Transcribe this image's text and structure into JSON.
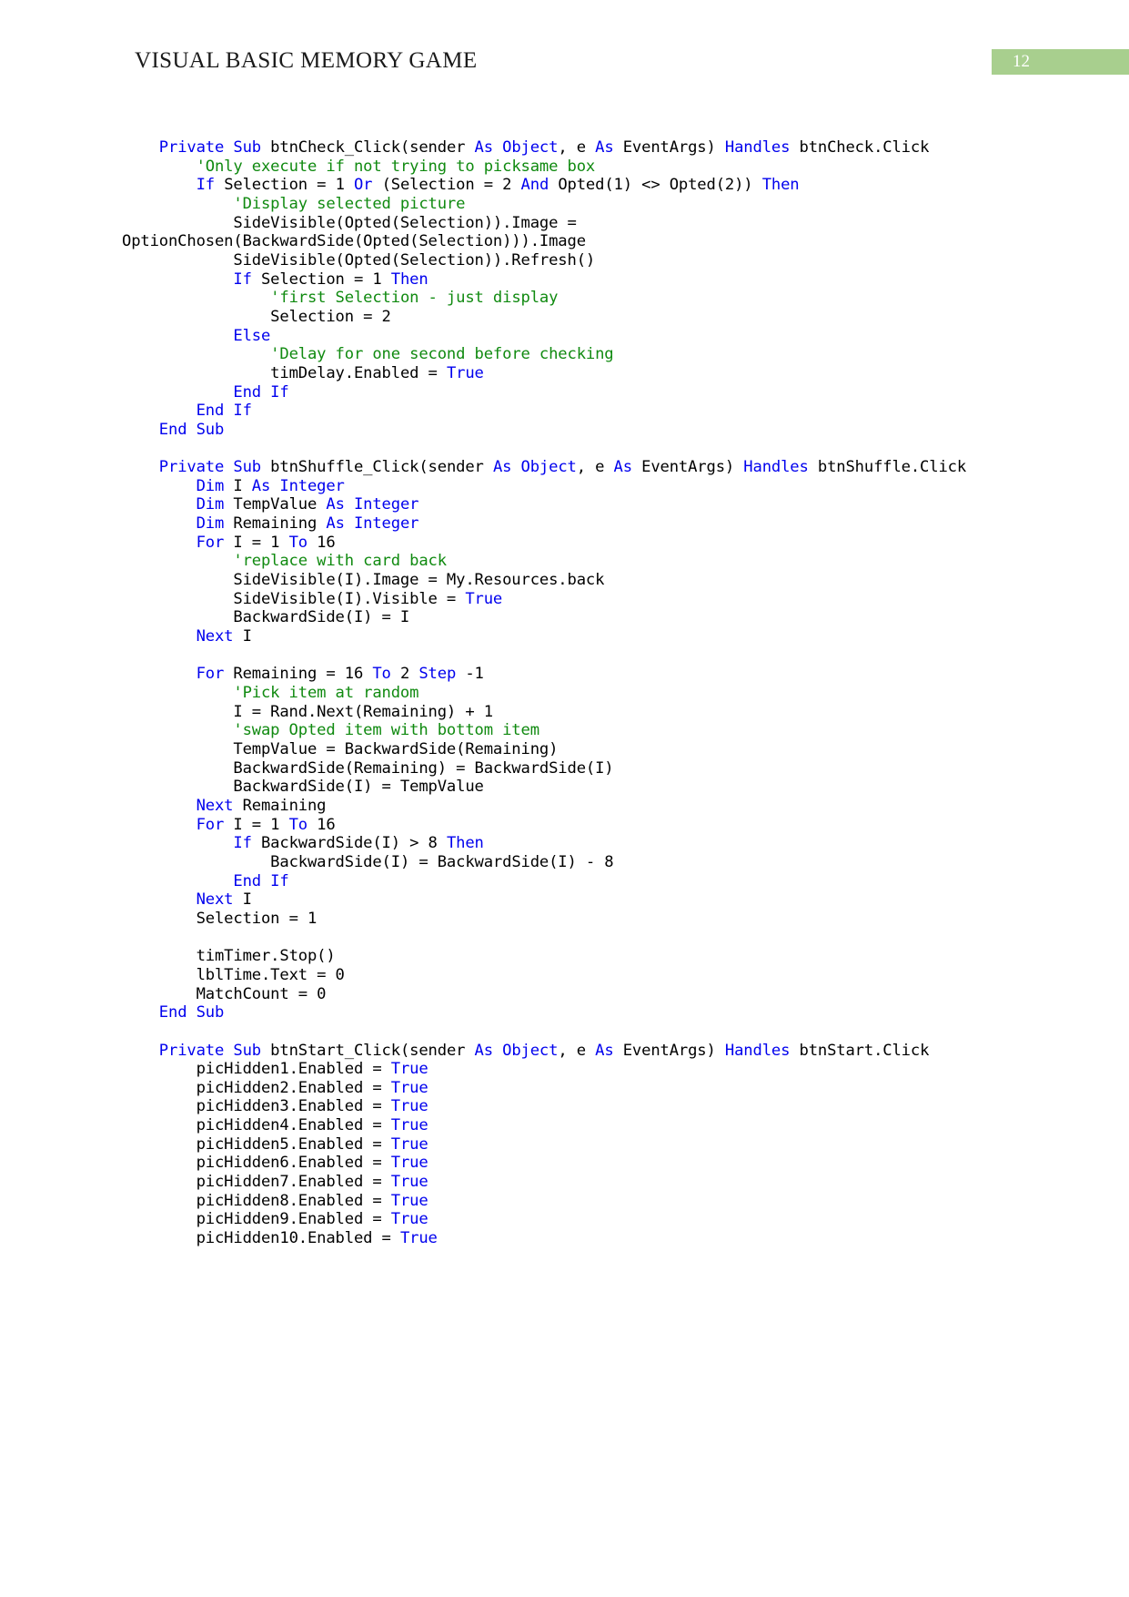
{
  "header": {
    "document_title": "VISUAL BASIC MEMORY GAME",
    "page_number": "12",
    "badge_color": "#a8cf8e"
  },
  "syntax_colors": {
    "keyword": "#0000ee",
    "comment": "#108a10",
    "identifier": "#000000"
  },
  "code": {
    "language": "Visual Basic .NET",
    "lines": [
      [
        {
          "t": "    ",
          "c": "idn"
        },
        {
          "t": "Private Sub",
          "c": "kw"
        },
        {
          "t": " btnCheck_Click(sender ",
          "c": "idn"
        },
        {
          "t": "As Object",
          "c": "kw"
        },
        {
          "t": ", e ",
          "c": "idn"
        },
        {
          "t": "As",
          "c": "kw"
        },
        {
          "t": " EventArgs) ",
          "c": "idn"
        },
        {
          "t": "Handles",
          "c": "kw"
        },
        {
          "t": " btnCheck.Click",
          "c": "idn"
        }
      ],
      [
        {
          "t": "        ",
          "c": "idn"
        },
        {
          "t": "'Only execute if not trying to picksame box",
          "c": "cmt"
        }
      ],
      [
        {
          "t": "        ",
          "c": "idn"
        },
        {
          "t": "If",
          "c": "kw"
        },
        {
          "t": " Selection = 1 ",
          "c": "idn"
        },
        {
          "t": "Or",
          "c": "kw"
        },
        {
          "t": " (Selection = 2 ",
          "c": "idn"
        },
        {
          "t": "And",
          "c": "kw"
        },
        {
          "t": " Opted(1) <> Opted(2)) ",
          "c": "idn"
        },
        {
          "t": "Then",
          "c": "kw"
        }
      ],
      [
        {
          "t": "            ",
          "c": "idn"
        },
        {
          "t": "'Display selected picture",
          "c": "cmt"
        }
      ],
      [
        {
          "t": "            SideVisible(Opted(Selection)).Image = OptionChosen(BackwardSide(Opted(Selection))).Image",
          "c": "idn"
        }
      ],
      [
        {
          "t": "            SideVisible(Opted(Selection)).Refresh()",
          "c": "idn"
        }
      ],
      [
        {
          "t": "            ",
          "c": "idn"
        },
        {
          "t": "If",
          "c": "kw"
        },
        {
          "t": " Selection = 1 ",
          "c": "idn"
        },
        {
          "t": "Then",
          "c": "kw"
        }
      ],
      [
        {
          "t": "                ",
          "c": "idn"
        },
        {
          "t": "'first Selection - just display",
          "c": "cmt"
        }
      ],
      [
        {
          "t": "                Selection = 2",
          "c": "idn"
        }
      ],
      [
        {
          "t": "            ",
          "c": "idn"
        },
        {
          "t": "Else",
          "c": "kw"
        }
      ],
      [
        {
          "t": "                ",
          "c": "idn"
        },
        {
          "t": "'Delay for one second before checking",
          "c": "cmt"
        }
      ],
      [
        {
          "t": "                timDelay.Enabled = ",
          "c": "idn"
        },
        {
          "t": "True",
          "c": "kw"
        }
      ],
      [
        {
          "t": "            ",
          "c": "idn"
        },
        {
          "t": "End If",
          "c": "kw"
        }
      ],
      [
        {
          "t": "        ",
          "c": "idn"
        },
        {
          "t": "End If",
          "c": "kw"
        }
      ],
      [
        {
          "t": "    ",
          "c": "idn"
        },
        {
          "t": "End Sub",
          "c": "kw"
        }
      ],
      [
        {
          "t": "",
          "c": "idn"
        }
      ],
      [
        {
          "t": "    ",
          "c": "idn"
        },
        {
          "t": "Private Sub",
          "c": "kw"
        },
        {
          "t": " btnShuffle_Click(sender ",
          "c": "idn"
        },
        {
          "t": "As Object",
          "c": "kw"
        },
        {
          "t": ", e ",
          "c": "idn"
        },
        {
          "t": "As",
          "c": "kw"
        },
        {
          "t": " EventArgs) ",
          "c": "idn"
        },
        {
          "t": "Handles",
          "c": "kw"
        },
        {
          "t": " btnShuffle.Click",
          "c": "idn"
        }
      ],
      [
        {
          "t": "        ",
          "c": "idn"
        },
        {
          "t": "Dim",
          "c": "kw"
        },
        {
          "t": " I ",
          "c": "idn"
        },
        {
          "t": "As Integer",
          "c": "kw"
        }
      ],
      [
        {
          "t": "        ",
          "c": "idn"
        },
        {
          "t": "Dim",
          "c": "kw"
        },
        {
          "t": " TempValue ",
          "c": "idn"
        },
        {
          "t": "As Integer",
          "c": "kw"
        }
      ],
      [
        {
          "t": "        ",
          "c": "idn"
        },
        {
          "t": "Dim",
          "c": "kw"
        },
        {
          "t": " Remaining ",
          "c": "idn"
        },
        {
          "t": "As Integer",
          "c": "kw"
        }
      ],
      [
        {
          "t": "        ",
          "c": "idn"
        },
        {
          "t": "For",
          "c": "kw"
        },
        {
          "t": " I = 1 ",
          "c": "idn"
        },
        {
          "t": "To",
          "c": "kw"
        },
        {
          "t": " 16",
          "c": "idn"
        }
      ],
      [
        {
          "t": "            ",
          "c": "idn"
        },
        {
          "t": "'replace with card back",
          "c": "cmt"
        }
      ],
      [
        {
          "t": "            SideVisible(I).Image = My.Resources.back",
          "c": "idn"
        }
      ],
      [
        {
          "t": "            SideVisible(I).Visible = ",
          "c": "idn"
        },
        {
          "t": "True",
          "c": "kw"
        }
      ],
      [
        {
          "t": "            BackwardSide(I) = I",
          "c": "idn"
        }
      ],
      [
        {
          "t": "        ",
          "c": "idn"
        },
        {
          "t": "Next",
          "c": "kw"
        },
        {
          "t": " I",
          "c": "idn"
        }
      ],
      [
        {
          "t": "",
          "c": "idn"
        }
      ],
      [
        {
          "t": "        ",
          "c": "idn"
        },
        {
          "t": "For",
          "c": "kw"
        },
        {
          "t": " Remaining = 16 ",
          "c": "idn"
        },
        {
          "t": "To",
          "c": "kw"
        },
        {
          "t": " 2 ",
          "c": "idn"
        },
        {
          "t": "Step",
          "c": "kw"
        },
        {
          "t": " -1",
          "c": "idn"
        }
      ],
      [
        {
          "t": "            ",
          "c": "idn"
        },
        {
          "t": "'Pick item at random",
          "c": "cmt"
        }
      ],
      [
        {
          "t": "            I = Rand.Next(Remaining) + 1",
          "c": "idn"
        }
      ],
      [
        {
          "t": "            ",
          "c": "idn"
        },
        {
          "t": "'swap Opted item with bottom item",
          "c": "cmt"
        }
      ],
      [
        {
          "t": "            TempValue = BackwardSide(Remaining)",
          "c": "idn"
        }
      ],
      [
        {
          "t": "            BackwardSide(Remaining) = BackwardSide(I)",
          "c": "idn"
        }
      ],
      [
        {
          "t": "            BackwardSide(I) = TempValue",
          "c": "idn"
        }
      ],
      [
        {
          "t": "        ",
          "c": "idn"
        },
        {
          "t": "Next",
          "c": "kw"
        },
        {
          "t": " Remaining",
          "c": "idn"
        }
      ],
      [
        {
          "t": "        ",
          "c": "idn"
        },
        {
          "t": "For",
          "c": "kw"
        },
        {
          "t": " I = 1 ",
          "c": "idn"
        },
        {
          "t": "To",
          "c": "kw"
        },
        {
          "t": " 16",
          "c": "idn"
        }
      ],
      [
        {
          "t": "            ",
          "c": "idn"
        },
        {
          "t": "If",
          "c": "kw"
        },
        {
          "t": " BackwardSide(I) > 8 ",
          "c": "idn"
        },
        {
          "t": "Then",
          "c": "kw"
        }
      ],
      [
        {
          "t": "                BackwardSide(I) = BackwardSide(I) - 8",
          "c": "idn"
        }
      ],
      [
        {
          "t": "            ",
          "c": "idn"
        },
        {
          "t": "End If",
          "c": "kw"
        }
      ],
      [
        {
          "t": "        ",
          "c": "idn"
        },
        {
          "t": "Next",
          "c": "kw"
        },
        {
          "t": " I",
          "c": "idn"
        }
      ],
      [
        {
          "t": "        Selection = 1",
          "c": "idn"
        }
      ],
      [
        {
          "t": "",
          "c": "idn"
        }
      ],
      [
        {
          "t": "        timTimer.Stop()",
          "c": "idn"
        }
      ],
      [
        {
          "t": "        lblTime.Text = 0",
          "c": "idn"
        }
      ],
      [
        {
          "t": "        MatchCount = 0",
          "c": "idn"
        }
      ],
      [
        {
          "t": "    ",
          "c": "idn"
        },
        {
          "t": "End Sub",
          "c": "kw"
        }
      ],
      [
        {
          "t": "",
          "c": "idn"
        }
      ],
      [
        {
          "t": "    ",
          "c": "idn"
        },
        {
          "t": "Private Sub",
          "c": "kw"
        },
        {
          "t": " btnStart_Click(sender ",
          "c": "idn"
        },
        {
          "t": "As Object",
          "c": "kw"
        },
        {
          "t": ", e ",
          "c": "idn"
        },
        {
          "t": "As",
          "c": "kw"
        },
        {
          "t": " EventArgs) ",
          "c": "idn"
        },
        {
          "t": "Handles",
          "c": "kw"
        },
        {
          "t": " btnStart.Click",
          "c": "idn"
        }
      ],
      [
        {
          "t": "        picHidden1.Enabled = ",
          "c": "idn"
        },
        {
          "t": "True",
          "c": "kw"
        }
      ],
      [
        {
          "t": "        picHidden2.Enabled = ",
          "c": "idn"
        },
        {
          "t": "True",
          "c": "kw"
        }
      ],
      [
        {
          "t": "        picHidden3.Enabled = ",
          "c": "idn"
        },
        {
          "t": "True",
          "c": "kw"
        }
      ],
      [
        {
          "t": "        picHidden4.Enabled = ",
          "c": "idn"
        },
        {
          "t": "True",
          "c": "kw"
        }
      ],
      [
        {
          "t": "        picHidden5.Enabled = ",
          "c": "idn"
        },
        {
          "t": "True",
          "c": "kw"
        }
      ],
      [
        {
          "t": "        picHidden6.Enabled = ",
          "c": "idn"
        },
        {
          "t": "True",
          "c": "kw"
        }
      ],
      [
        {
          "t": "        picHidden7.Enabled = ",
          "c": "idn"
        },
        {
          "t": "True",
          "c": "kw"
        }
      ],
      [
        {
          "t": "        picHidden8.Enabled = ",
          "c": "idn"
        },
        {
          "t": "True",
          "c": "kw"
        }
      ],
      [
        {
          "t": "        picHidden9.Enabled = ",
          "c": "idn"
        },
        {
          "t": "True",
          "c": "kw"
        }
      ],
      [
        {
          "t": "        picHidden10.Enabled = ",
          "c": "idn"
        },
        {
          "t": "True",
          "c": "kw"
        }
      ]
    ]
  }
}
